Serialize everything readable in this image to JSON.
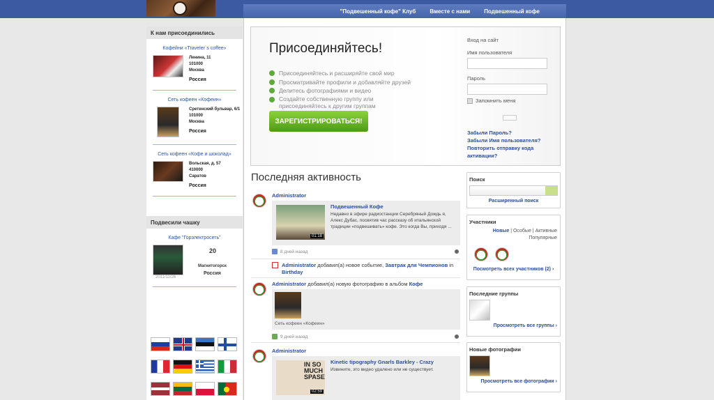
{
  "nav": {
    "items": [
      "\"Подвешенный кофе\" Клуб",
      "Вместе с нами",
      "Подвешенный кофе"
    ]
  },
  "left": {
    "joined_title": "К нам присоединились",
    "locations": [
      {
        "title": "Кофейни «Traveler`s coffee»",
        "address": [
          "Ленина, 11",
          "101000",
          "Москва"
        ],
        "country": "Россия"
      },
      {
        "title": "Сеть кофеен «Кофеин»",
        "address": [
          "Сретенский бульвар, 6/1",
          "101000",
          "Москва"
        ],
        "country": "Россия"
      },
      {
        "title": "Сеть кофеен «Кофе и шоколад»",
        "address": [
          "Вольская, д. 57",
          "410000",
          "Саратов"
        ],
        "country": "Россия"
      }
    ],
    "cup_title": "Подвесили чашку",
    "cup": {
      "name": "Кафе \"Горэлектросеть\"",
      "count": "20",
      "date": "2011/11/26",
      "city": "Магнитогорск",
      "country": "Россия"
    }
  },
  "join": {
    "title": "Присоединяйтесь!",
    "bullets": [
      "Присоединяйтесь и расширяйте свой мир",
      "Просматривайте профили и добавляйте друзей",
      "Делитесь фотографиями и видео",
      "Создайте собственную группу или присоединяйтесь к другим группам"
    ],
    "register": "ЗАРЕГИСТРИРОВАТЬСЯ!"
  },
  "login": {
    "title": "Вход на сайт",
    "username": "Имя пользователя",
    "password": "Пароль",
    "remember": "Запомнить меня",
    "links": [
      "Забыли Пароль?",
      "Забыли Имя пользователя?",
      "Повторить отправку кода активации?"
    ]
  },
  "activity": {
    "title": "Последняя активность",
    "items": [
      {
        "who": "Administrator",
        "video_title": "Подвешенный Кофе",
        "desc": "Недавно в эфире радиостанции Серебряный Дождь я, Алекс Дубас, посвятив час рассказу об итальянской традиции «подвешивать» кофе. Это когда Вы, приходя ...",
        "duration": "01:18",
        "time": "8 дней назад"
      },
      {
        "who": "Administrator",
        "text": "добавил(а) новое событие,",
        "event": "Завтрак для Чемпионов",
        "in": "in",
        "cat": "Birthday"
      },
      {
        "who": "Administrator",
        "text": "добавил(а) новую фотографию в альбом",
        "album": "Кофе",
        "caption": "Сеть кофеен «Кофеин»",
        "time": "9 дней назад"
      },
      {
        "who": "Administrator",
        "video_title": "Kinetic tipography Gnarls Barkley - Crazy",
        "desc": "Извините, это видео удалено или не существует.",
        "duration": "02:59",
        "thumb_text": "IN SO MUCH SPASE"
      }
    ]
  },
  "right": {
    "search": {
      "title": "Поиск",
      "advanced": "Расширенный поиск"
    },
    "members": {
      "title": "Участники",
      "tabs": [
        "Новые",
        "Особые",
        "Активные",
        "Популярные"
      ],
      "all": "Посмотреть всех участников (2) ›"
    },
    "groups": {
      "title": "Последние группы",
      "all": "Просмотреть все группы ›"
    },
    "photos": {
      "title": "Новые фотографии",
      "all": "Просмотреть все фотографии ›"
    }
  }
}
